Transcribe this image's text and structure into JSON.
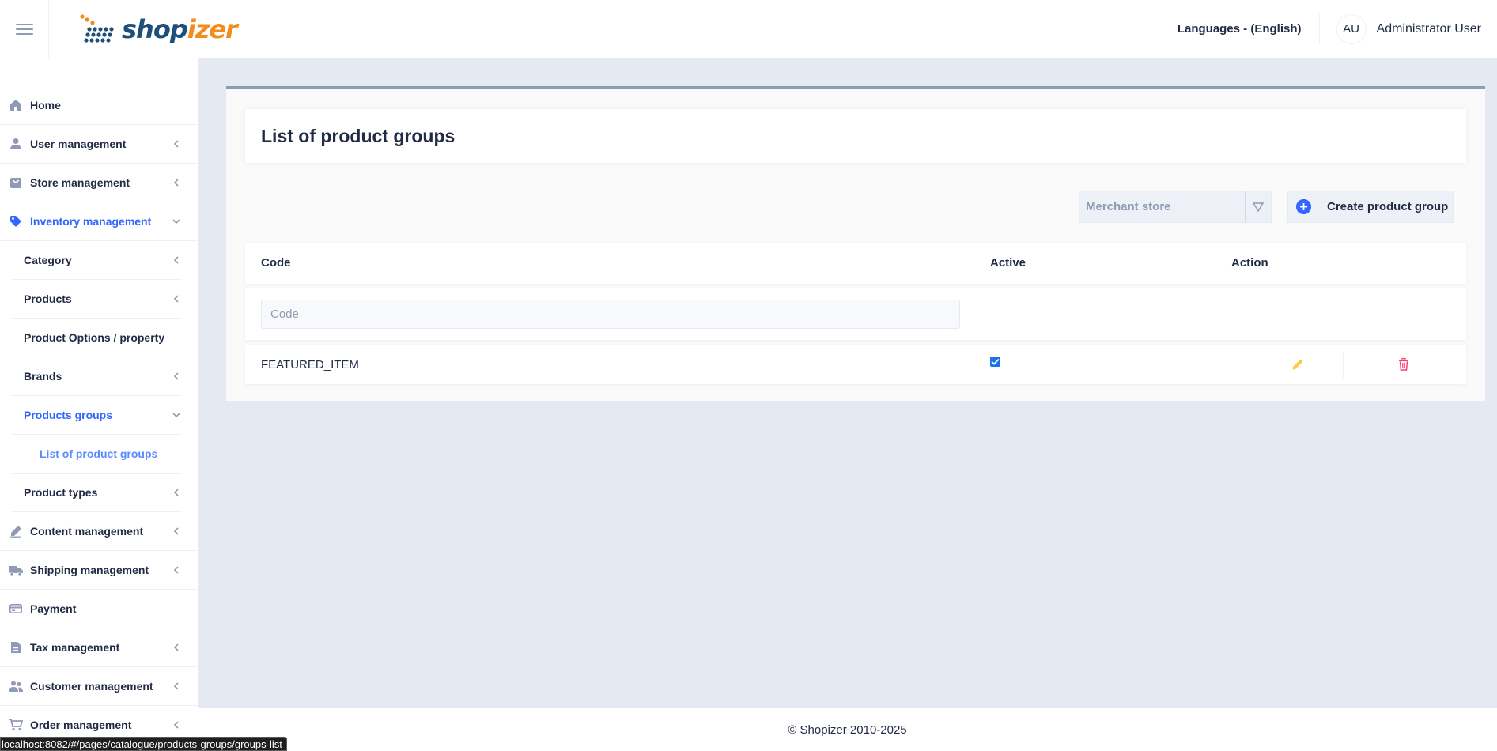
{
  "header": {
    "logo": {
      "part1": "shop",
      "part2": "izer"
    },
    "language": "Languages - (English)",
    "user": {
      "initials": "AU",
      "name": "Administrator User"
    }
  },
  "sidebar": {
    "items": [
      {
        "label": "Home",
        "icon": "home-icon"
      },
      {
        "label": "User management",
        "icon": "person-icon"
      },
      {
        "label": "Store management",
        "icon": "store-icon"
      },
      {
        "label": "Inventory management",
        "icon": "tag-icon"
      },
      {
        "label": "Content management",
        "icon": "pen-icon"
      },
      {
        "label": "Shipping management",
        "icon": "truck-icon"
      },
      {
        "label": "Payment",
        "icon": "credit-card-icon"
      },
      {
        "label": "Tax management",
        "icon": "file-icon"
      },
      {
        "label": "Customer management",
        "icon": "people-icon"
      },
      {
        "label": "Order management",
        "icon": "cart-icon"
      }
    ],
    "inventory_sub": [
      {
        "label": "Category"
      },
      {
        "label": "Products"
      },
      {
        "label": "Product Options / property"
      },
      {
        "label": "Brands"
      },
      {
        "label": "Products groups"
      },
      {
        "label": "Product types"
      }
    ],
    "groups_sub": [
      {
        "label": "List of product groups"
      }
    ]
  },
  "main": {
    "title": "List of product groups",
    "merchant_select": "Merchant store",
    "create_button": "Create product group",
    "table": {
      "columns": [
        "Code",
        "Active",
        "Action"
      ],
      "filter_placeholder": "Code",
      "rows": [
        {
          "code": "FEATURED_ITEM",
          "active": true
        }
      ]
    }
  },
  "footer": {
    "text": "© Shopizer 2010-2025"
  },
  "status_bar": {
    "url": "localhost:8082/#/pages/catalogue/products-groups/groups-list"
  },
  "colors": {
    "accent": "#3366ff",
    "edit": "#ffc94d",
    "delete": "#ff3d71",
    "text": "#222b45"
  }
}
